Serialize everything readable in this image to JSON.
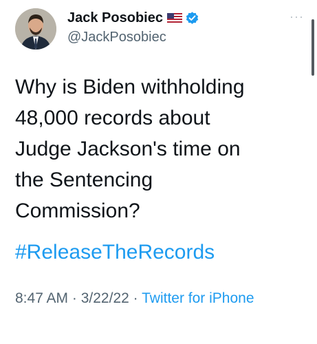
{
  "author": {
    "name": "Jack Posobiec",
    "handle": "@JackPosobiec",
    "flag_icon": "us-flag-icon",
    "verified_icon": "verified-badge-icon"
  },
  "tweet": {
    "text": "Why is Biden withholding\n48,000 records about\nJudge Jackson's time on\nthe Sentencing\nCommission?",
    "hashtag": "#ReleaseTheRecords",
    "time": "8:47 AM",
    "sep1": " · ",
    "date": "3/22/22",
    "sep2": " · ",
    "source": "Twitter for iPhone"
  },
  "colors": {
    "link": "#1d9bf0",
    "muted": "#536471",
    "text": "#0f1419"
  },
  "more_icon": "more-options-icon"
}
